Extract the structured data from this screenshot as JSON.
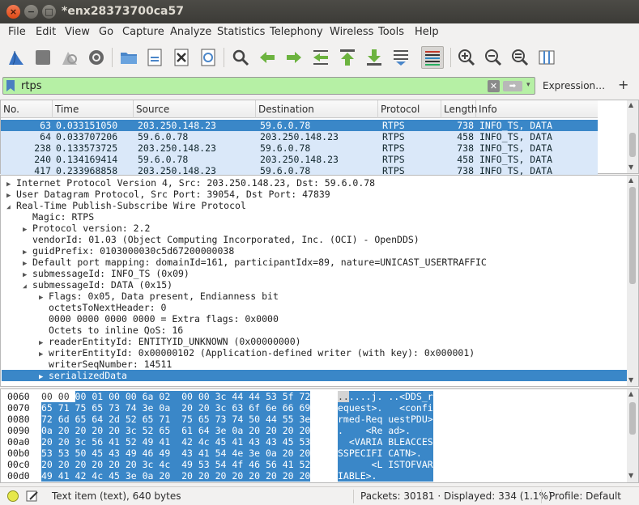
{
  "window": {
    "title": "*enx28373700ca57",
    "close_glyph": "×",
    "min_glyph": "−",
    "max_glyph": "□"
  },
  "menu": [
    "File",
    "Edit",
    "View",
    "Go",
    "Capture",
    "Analyze",
    "Statistics",
    "Telephony",
    "Wireless",
    "Tools",
    "Help"
  ],
  "filter": {
    "value": "rtps",
    "expression_label": "Expression…",
    "add_label": "+",
    "clear_glyph": "✕",
    "apply_glyph": "➡",
    "drop_glyph": "▾"
  },
  "packet_list": {
    "columns": [
      "No.",
      "Time",
      "Source",
      "Destination",
      "Protocol",
      "Length",
      "Info"
    ],
    "rows": [
      {
        "no": "63",
        "time": "0.033151050",
        "src": "203.250.148.23",
        "dst": "59.6.0.78",
        "proto": "RTPS",
        "len": "738",
        "info": "INFO_TS, DATA"
      },
      {
        "no": "64",
        "time": "0.033707206",
        "src": "59.6.0.78",
        "dst": "203.250.148.23",
        "proto": "RTPS",
        "len": "458",
        "info": "INFO_TS, DATA"
      },
      {
        "no": "238",
        "time": "0.133573725",
        "src": "203.250.148.23",
        "dst": "59.6.0.78",
        "proto": "RTPS",
        "len": "738",
        "info": "INFO_TS, DATA"
      },
      {
        "no": "240",
        "time": "0.134169414",
        "src": "59.6.0.78",
        "dst": "203.250.148.23",
        "proto": "RTPS",
        "len": "458",
        "info": "INFO_TS, DATA"
      },
      {
        "no": "417",
        "time": "0.233968858",
        "src": "203.250.148.23",
        "dst": "59.6.0.78",
        "proto": "RTPS",
        "len": "738",
        "info": "INFO_TS, DATA"
      }
    ]
  },
  "details": [
    "Internet Protocol Version 4, Src: 203.250.148.23, Dst: 59.6.0.78",
    "User Datagram Protocol, Src Port: 39054, Dst Port: 47839",
    "Real-Time Publish-Subscribe Wire Protocol",
    "Magic: RTPS",
    "Protocol version: 2.2",
    "vendorId: 01.03 (Object Computing Incorporated, Inc. (OCI) - OpenDDS)",
    "guidPrefix: 0103000030c5d67200000038",
    "Default port mapping: domainId=161, participantIdx=89, nature=UNICAST_USERTRAFFIC",
    "submessageId: INFO_TS (0x09)",
    "submessageId: DATA (0x15)",
    "Flags: 0x05, Data present, Endianness bit",
    "octetsToNextHeader: 0",
    "0000 0000 0000 0000 = Extra flags: 0x0000",
    "Octets to inline QoS: 16",
    "readerEntityId: ENTITYID_UNKNOWN (0x00000000)",
    "writerEntityId: 0x00000102 (Application-defined writer (with key): 0x000001)",
    "writerSeqNumber: 14511",
    "serializedData"
  ],
  "bytes": [
    {
      "off": "0060",
      "hex_pre": "00 00 ",
      "hex_hl": "00 01 00 00 6a 02  00 00 3c 44 44 53 5f 72",
      "ascii_pre": "..",
      "ascii_hl": "....j. ..<DDS_r"
    },
    {
      "off": "0070",
      "hex_pre": "",
      "hex_hl": "65 71 75 65 73 74 3e 0a  20 20 3c 63 6f 6e 66 69",
      "ascii_pre": "",
      "ascii_hl": "equest>.   <confi"
    },
    {
      "off": "0080",
      "hex_pre": "",
      "hex_hl": "72 6d 65 64 2d 52 65 71  75 65 73 74 50 44 55 3e",
      "ascii_pre": "",
      "ascii_hl": "rmed-Req uestPDU>"
    },
    {
      "off": "0090",
      "hex_pre": "",
      "hex_hl": "0a 20 20 20 20 3c 52 65  61 64 3e 0a 20 20 20 20",
      "ascii_pre": "",
      "ascii_hl": ".    <Re ad>.    "
    },
    {
      "off": "00a0",
      "hex_pre": "",
      "hex_hl": "20 20 3c 56 41 52 49 41  42 4c 45 41 43 43 45 53",
      "ascii_pre": "",
      "ascii_hl": "  <VARIA BLEACCES"
    },
    {
      "off": "00b0",
      "hex_pre": "",
      "hex_hl": "53 53 50 45 43 49 46 49  43 41 54 4e 3e 0a 20 20",
      "ascii_pre": "",
      "ascii_hl": "SSPECIFI CATN>.  "
    },
    {
      "off": "00c0",
      "hex_pre": "",
      "hex_hl": "20 20 20 20 20 20 3c 4c  49 53 54 4f 46 56 41 52",
      "ascii_pre": "",
      "ascii_hl": "      <L ISTOFVAR"
    },
    {
      "off": "00d0",
      "hex_pre": "",
      "hex_hl": "49 41 42 4c 45 3e 0a 20  20 20 20 20 20 20 20 20",
      "ascii_pre": "",
      "ascii_hl": "IABLE>.          "
    }
  ],
  "status": {
    "item": "Text item (text), 640 bytes",
    "packets": "Packets: 30181 · Displayed: 334 (1.1%)",
    "profile": "Profile: Default"
  },
  "colors": {
    "selection": "#3a87c8",
    "row_bg": "#dae8f9",
    "filter_bg": "#b6f0a5"
  },
  "icons": [
    "shark-fin-start-icon",
    "stop-square-icon",
    "restart-fin-icon",
    "gear-options-icon",
    "open-folder-icon",
    "save-file-icon",
    "close-file-icon",
    "reload-icon",
    "find-magnifier-icon",
    "go-back-icon",
    "go-forward-icon",
    "go-to-packet-icon",
    "first-packet-icon",
    "last-packet-icon",
    "autoscroll-icon",
    "colorize-icon",
    "zoom-in-icon",
    "zoom-out-icon",
    "normal-size-icon",
    "resize-columns-icon"
  ]
}
